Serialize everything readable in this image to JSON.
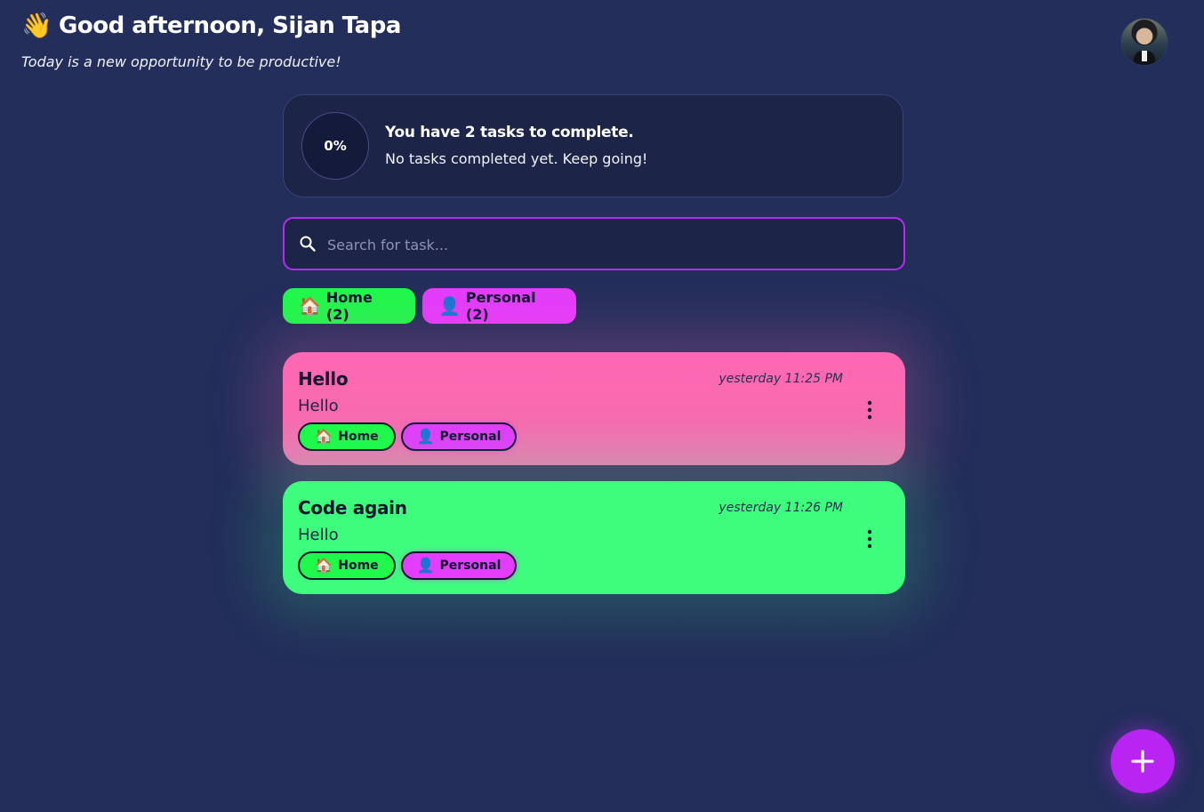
{
  "header": {
    "wave_emoji": "👋",
    "title": "Good afternoon, Sijan Tapa",
    "subtitle": "Today is a new opportunity to be productive!",
    "avatar_icon": "user-avatar"
  },
  "progress": {
    "percent_label": "0%",
    "percent_value": 0,
    "title": "You have 2 tasks to complete.",
    "subtitle": "No tasks completed yet. Keep going!"
  },
  "search": {
    "placeholder": "Search for task...",
    "value": "",
    "icon": "search-icon"
  },
  "categories": [
    {
      "emoji": "🏠",
      "label": "Home (2)",
      "color": "#1ef94b"
    },
    {
      "emoji": "👤",
      "label": "Personal (2)",
      "color": "#e33cfb"
    }
  ],
  "tasks": [
    {
      "title": "Hello",
      "description": "Hello",
      "time": "yesterday 11:25 PM",
      "color": "#ff68b2",
      "tags": [
        {
          "emoji": "🏠",
          "label": "Home"
        },
        {
          "emoji": "👤",
          "label": "Personal"
        }
      ]
    },
    {
      "title": "Code again",
      "description": "Hello",
      "time": "yesterday 11:26 PM",
      "color": "#3efd7d",
      "tags": [
        {
          "emoji": "🏠",
          "label": "Home"
        },
        {
          "emoji": "👤",
          "label": "Personal"
        }
      ]
    }
  ],
  "fab": {
    "icon": "plus-icon",
    "color": "#b825f2"
  },
  "colors": {
    "background": "#232e5b",
    "accent": "#b62cf3"
  }
}
